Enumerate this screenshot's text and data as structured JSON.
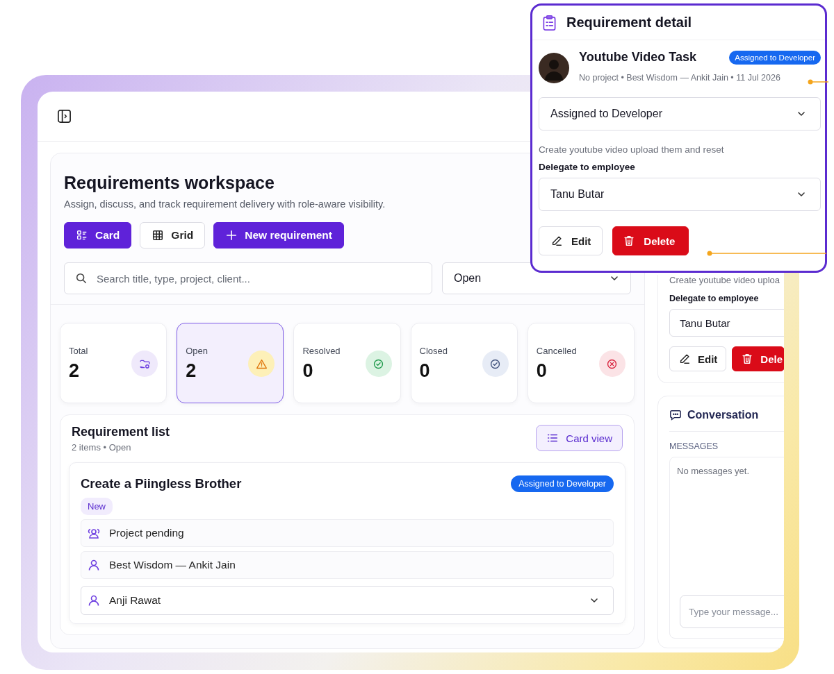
{
  "workspace": {
    "title": "Requirements workspace",
    "subtitle": "Assign, discuss, and track requirement delivery with role-aware visibility.",
    "view_buttons": [
      {
        "label": "Card",
        "kind": "card",
        "selected": true
      },
      {
        "label": "Grid",
        "kind": "grid",
        "selected": false
      }
    ],
    "new_button": "New requirement",
    "search": {
      "placeholder": "Search title, type, project, client..."
    },
    "status_filter": "Open"
  },
  "stats": [
    {
      "label": "Total",
      "value": "2",
      "kind": "total",
      "selected": false
    },
    {
      "label": "Open",
      "value": "2",
      "kind": "open",
      "selected": true
    },
    {
      "label": "Resolved",
      "value": "0",
      "kind": "resolved",
      "selected": false
    },
    {
      "label": "Closed",
      "value": "0",
      "kind": "closed",
      "selected": false
    },
    {
      "label": "Cancelled",
      "value": "0",
      "kind": "cancelled",
      "selected": false
    }
  ],
  "requirement_list": {
    "title": "Requirement list",
    "summary": "2 items • Open",
    "view_button": "Card view",
    "items": [
      {
        "title": "Create a Piingless Brother",
        "status": "Assigned to Developer",
        "tag": "New",
        "rows": [
          {
            "kind": "project",
            "text": "Project pending"
          },
          {
            "kind": "client",
            "text": "Best Wisdom — Ankit Jain"
          },
          {
            "kind": "assignee",
            "text": "Anji Rawat"
          }
        ]
      }
    ]
  },
  "detail_card": {
    "description": "Create youtube video uploa",
    "delegate_label": "Delegate to employee",
    "delegate_value": "Tanu Butar",
    "buttons": [
      {
        "label": "Edit",
        "kind": "edit"
      },
      {
        "label": "Dele",
        "kind": "delete"
      }
    ]
  },
  "conversation": {
    "title": "Conversation",
    "messages_label": "MESSAGES",
    "empty_text": "No messages yet.",
    "input_placeholder": "Type your message..."
  },
  "detail_popup": {
    "title": "Requirement detail",
    "task_title": "Youtube Video Task",
    "status_badge": "Assigned to Developer",
    "meta": "No project • Best Wisdom — Ankit Jain • 11 Jul 2026",
    "status_value": "Assigned to Developer",
    "description": "Create youtube video upload them and reset",
    "delegate_label": "Delegate to employee",
    "delegate_value": "Tanu Butar",
    "buttons": [
      {
        "label": "Edit",
        "kind": "edit"
      },
      {
        "label": "Delete",
        "kind": "delete"
      }
    ]
  }
}
